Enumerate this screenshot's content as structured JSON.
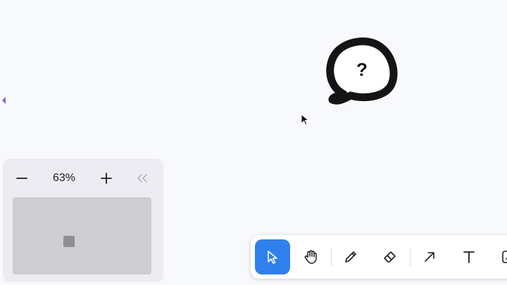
{
  "canvas": {
    "background": "#f8f9fc",
    "bubble_text": "?"
  },
  "zoom": {
    "level": "63%",
    "minus_icon": "minus-icon",
    "plus_icon": "plus-icon",
    "collapse_icon": "chevrons-left-icon"
  },
  "toolbar": {
    "active_color": "#2f80ed",
    "tools": [
      {
        "name": "select",
        "icon": "pointer-icon",
        "active": true
      },
      {
        "name": "hand",
        "icon": "hand-icon",
        "active": false
      },
      {
        "name": "draw",
        "icon": "pencil-icon",
        "active": false
      },
      {
        "name": "eraser",
        "icon": "eraser-icon",
        "active": false
      },
      {
        "name": "arrow",
        "icon": "arrow-icon",
        "active": false
      },
      {
        "name": "text",
        "icon": "text-icon",
        "active": false
      },
      {
        "name": "asset",
        "icon": "image-icon",
        "active": false
      }
    ]
  }
}
